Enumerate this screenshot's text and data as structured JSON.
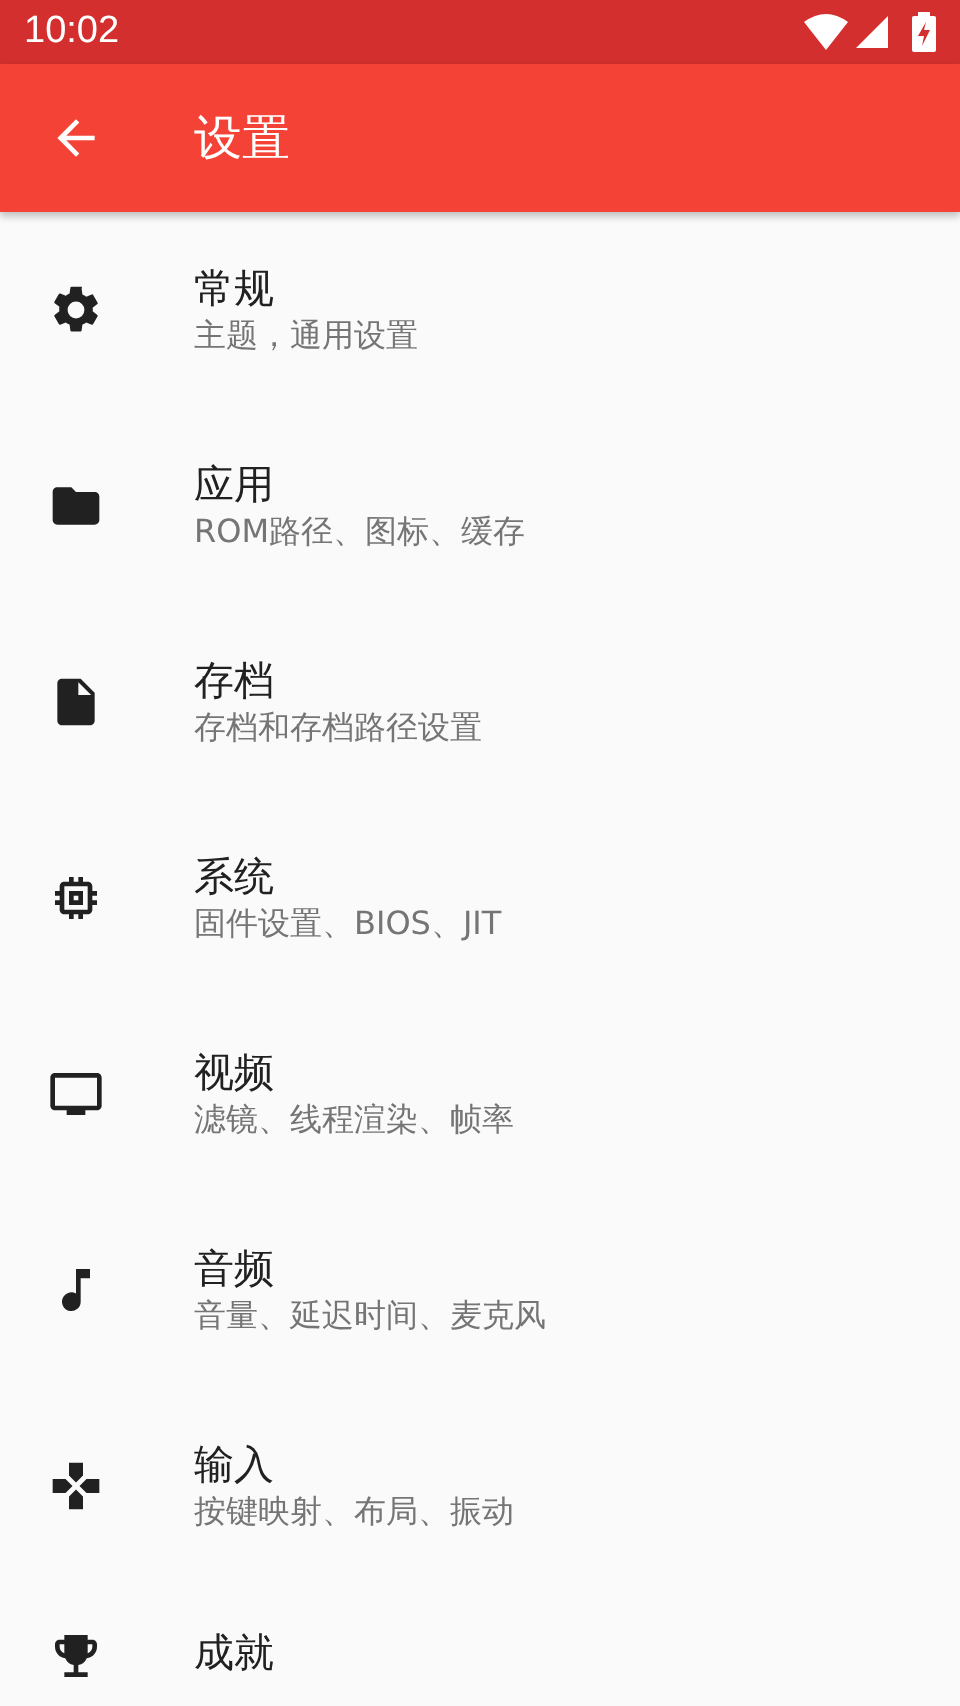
{
  "status_bar": {
    "time": "10:02"
  },
  "toolbar": {
    "title": "设置"
  },
  "items": [
    {
      "title": "常规",
      "subtitle": "主题，通用设置"
    },
    {
      "title": "应用",
      "subtitle": "ROM路径、图标、缓存"
    },
    {
      "title": "存档",
      "subtitle": "存档和存档路径设置"
    },
    {
      "title": "系统",
      "subtitle": "固件设置、BIOS、JIT"
    },
    {
      "title": "视频",
      "subtitle": "滤镜、线程渲染、帧率"
    },
    {
      "title": "音频",
      "subtitle": "音量、延迟时间、麦克风"
    },
    {
      "title": "输入",
      "subtitle": "按键映射、布局、振动"
    },
    {
      "title": "成就"
    }
  ]
}
